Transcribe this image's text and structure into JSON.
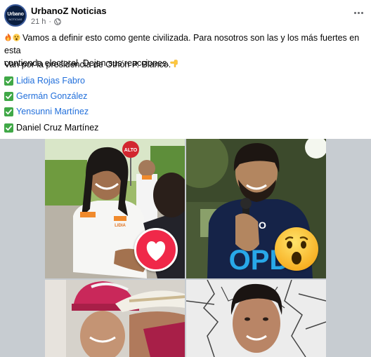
{
  "post": {
    "page_name": "UrbanoZ Noticias",
    "avatar_text": "Urbano",
    "avatar_sub": "NOTICIAS",
    "timestamp": "21 h",
    "separator": "·",
    "text_line1": "Vamos a definir esto como gente civilizada. Para nosotros son las y los más fuertes en esta",
    "text_line2": "contienda electoral. Dejen sus reacciones.",
    "subline": "Van por la presidencia de Othón P. Blanco."
  },
  "candidates": [
    {
      "name": "Lidia Rojas Fabro",
      "linked": true
    },
    {
      "name": "Germán González",
      "linked": true
    },
    {
      "name": "Yensunni Martínez",
      "linked": true
    },
    {
      "name": "Daniel Cruz Martínez",
      "linked": false
    }
  ],
  "icons": {
    "more": "more-options-icon",
    "globe": "globe-icon",
    "check": "check-mark-icon",
    "fire": "fire-emoji",
    "wow": "astonished-emoji",
    "hand": "pointing-down-emoji",
    "love": "love-reaction-icon",
    "wow_reaction": "wow-reaction-icon"
  },
  "photos": {
    "tile1_sign": "ALTO",
    "tile1_shirt": "LIDIA",
    "tile2_shirt": "OPD",
    "tile2_shirt_top": "EMO"
  },
  "colors": {
    "link": "#216fdb",
    "check": "#40a847",
    "love": "#f02849",
    "wow": "#f7b125",
    "muted": "#65676b"
  }
}
